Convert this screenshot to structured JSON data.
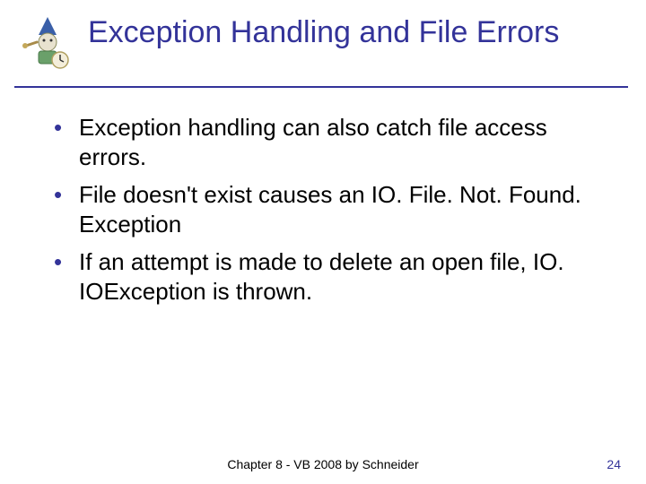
{
  "title": "Exception Handling and File Errors",
  "bullets": [
    "Exception handling can also catch file access errors.",
    "File doesn't exist causes an IO. File. Not. Found. Exception",
    "If an attempt is made to delete an open file, IO. IOException is thrown."
  ],
  "footer": {
    "center": "Chapter 8 - VB 2008 by Schneider",
    "page": "24"
  },
  "icon": "wizard-robot-clock-icon"
}
